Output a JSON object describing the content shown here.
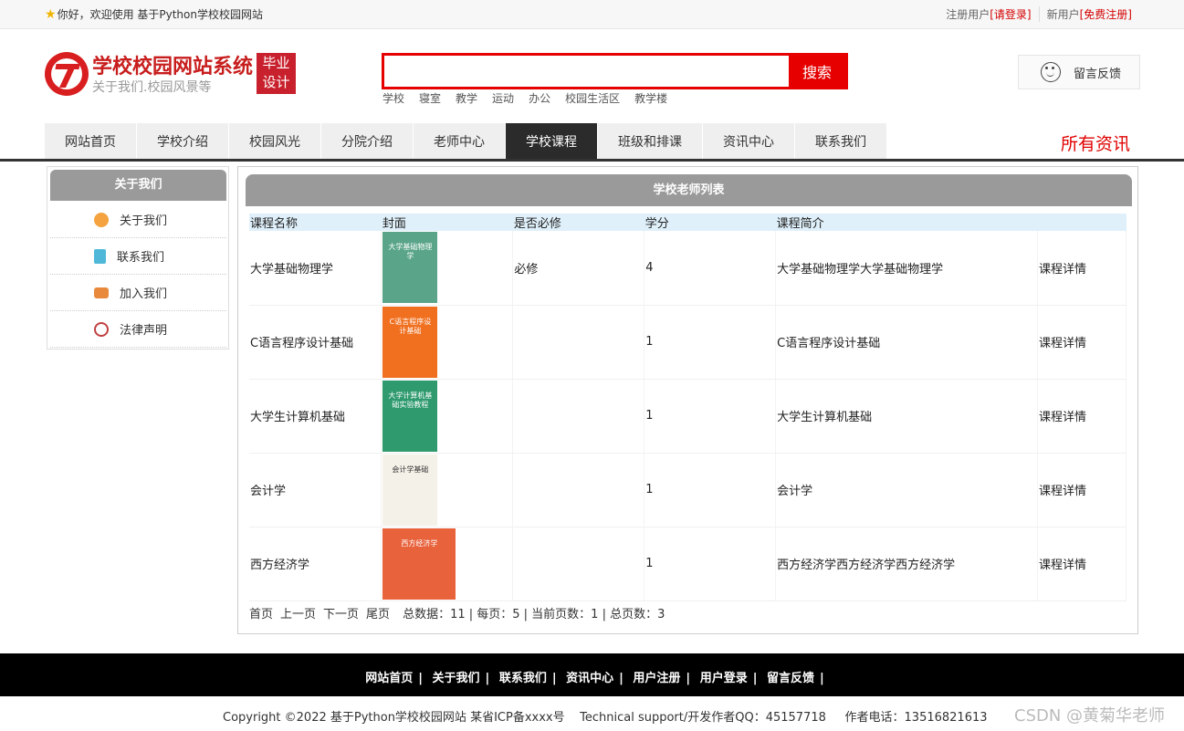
{
  "topbar": {
    "welcome": "你好，欢迎使用 基于Python学校校园网站",
    "register_prefix": "注册用户",
    "login_link": "[请登录]",
    "new_prefix": "新用户",
    "register_link": "[免费注册]"
  },
  "header": {
    "title": "学校校园网站系统",
    "subtitle": "关于我们.校园风景等",
    "tag_line1": "毕业",
    "tag_line2": "设计"
  },
  "search": {
    "value": "",
    "placeholder": "",
    "button": "搜索",
    "hotwords": [
      "学校",
      "寝室",
      "教学",
      "运动",
      "办公",
      "校园生活区",
      "教学楼"
    ]
  },
  "feedback": {
    "label": "留言反馈"
  },
  "nav": {
    "items": [
      {
        "label": "网站首页",
        "active": false
      },
      {
        "label": "学校介绍",
        "active": false
      },
      {
        "label": "校园风光",
        "active": false
      },
      {
        "label": "分院介绍",
        "active": false
      },
      {
        "label": "老师中心",
        "active": false
      },
      {
        "label": "学校课程",
        "active": true
      },
      {
        "label": "班级和排课",
        "active": false
      },
      {
        "label": "资讯中心",
        "active": false
      },
      {
        "label": "联系我们",
        "active": false
      }
    ],
    "right_label": "所有资讯"
  },
  "sidebar": {
    "title": "关于我们",
    "items": [
      {
        "label": "关于我们",
        "icon": "compass-icon"
      },
      {
        "label": "联系我们",
        "icon": "clipboard-icon"
      },
      {
        "label": "加入我们",
        "icon": "lock-icon"
      },
      {
        "label": "法律声明",
        "icon": "power-icon"
      }
    ]
  },
  "main": {
    "title": "学校老师列表",
    "columns": [
      "课程名称",
      "封面",
      "是否必修",
      "学分",
      "课程简介",
      ""
    ],
    "rows": [
      {
        "name": "大学基础物理学",
        "required": "必修",
        "credit": "4",
        "intro": "大学基础物理学大学基础物理学",
        "action": "课程详情",
        "cover_title": "大学基础物理学",
        "cover_color": "#5aa58a"
      },
      {
        "name": "C语言程序设计基础",
        "required": "",
        "credit": "1",
        "intro": "C语言程序设计基础",
        "action": "课程详情",
        "cover_title": "C语言程序设计基础",
        "cover_color": "#f07020"
      },
      {
        "name": "大学生计算机基础",
        "required": "",
        "credit": "1",
        "intro": "大学生计算机基础",
        "action": "课程详情",
        "cover_title": "大学计算机基础实验教程",
        "cover_color": "#2e9a6e"
      },
      {
        "name": "会计学",
        "required": "",
        "credit": "1",
        "intro": "会计学",
        "action": "课程详情",
        "cover_title": "会计学基础",
        "cover_color": "#f4f1e8"
      },
      {
        "name": "西方经济学",
        "required": "",
        "credit": "1",
        "intro": "西方经济学西方经济学西方经济学",
        "action": "课程详情",
        "cover_title": "西方经济学",
        "cover_color": "#e8623c"
      }
    ]
  },
  "pager": {
    "first": "首页",
    "prev": "上一页",
    "next": "下一页",
    "last": "尾页",
    "stats": "总数据：11 | 每页：5 | 当前页数：1 | 总页数：3"
  },
  "footer": {
    "links": [
      "网站首页",
      "关于我们",
      "联系我们",
      "资讯中心",
      "用户注册",
      "用户登录",
      "留言反馈"
    ],
    "copyright": "Copyright ©2022 基于Python学校校园网站 某省ICP备xxxx号    Technical support/开发作者QQ：45157718     作者电话：13516821613",
    "watermark": "CSDN @黄菊华老师"
  }
}
